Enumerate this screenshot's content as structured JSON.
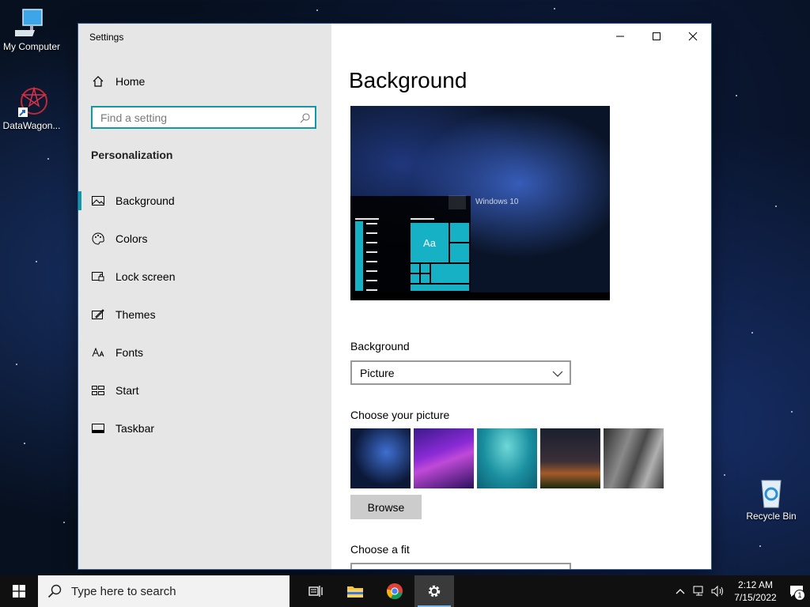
{
  "desktop": {
    "icons": [
      {
        "label": "My Computer"
      },
      {
        "label": "DataWagon..."
      },
      {
        "label": "Recycle Bin"
      }
    ]
  },
  "window": {
    "title": "Settings",
    "home_label": "Home",
    "search_placeholder": "Find a setting",
    "section_title": "Personalization",
    "nav": [
      {
        "label": "Background",
        "icon": "picture-icon",
        "active": true
      },
      {
        "label": "Colors",
        "icon": "palette-icon"
      },
      {
        "label": "Lock screen",
        "icon": "lock-screen-icon"
      },
      {
        "label": "Themes",
        "icon": "themes-icon"
      },
      {
        "label": "Fonts",
        "icon": "fonts-icon"
      },
      {
        "label": "Start",
        "icon": "start-icon"
      },
      {
        "label": "Taskbar",
        "icon": "taskbar-icon"
      }
    ],
    "page_title": "Background",
    "preview": {
      "tile_text": "Aa",
      "windows_text": "Windows 10"
    },
    "background_label": "Background",
    "background_value": "Picture",
    "choose_picture_label": "Choose your picture",
    "browse_label": "Browse",
    "choose_fit_label": "Choose a fit"
  },
  "taskbar": {
    "search_placeholder": "Type here to search",
    "time": "2:12 AM",
    "date": "7/15/2022",
    "notification_count": "1"
  },
  "colors": {
    "accent": "#0f9aa8",
    "tile": "#16b1c4"
  }
}
